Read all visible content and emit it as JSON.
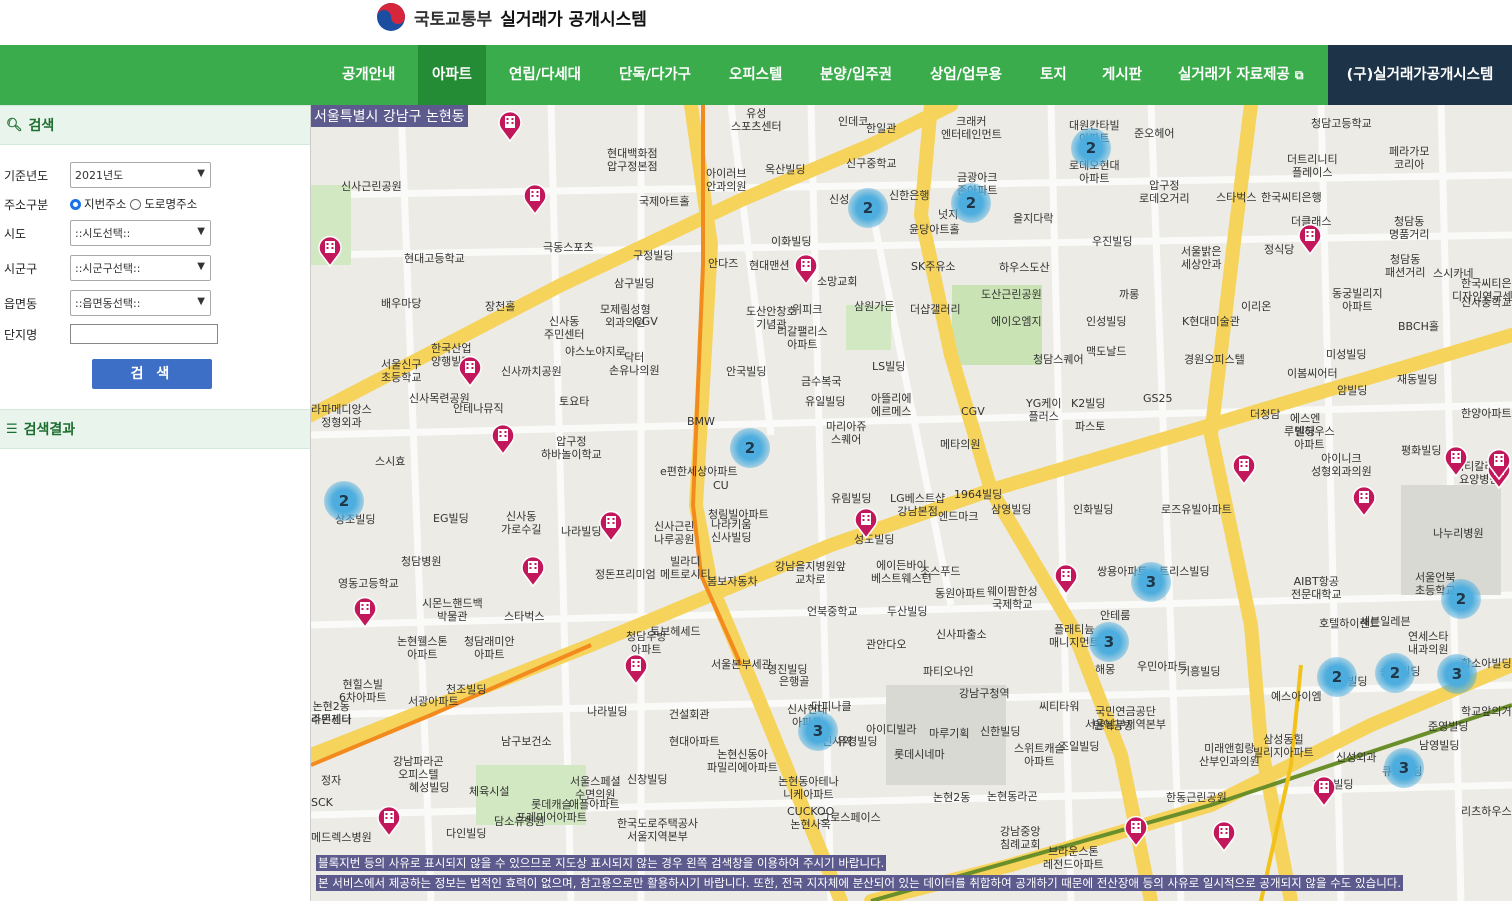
{
  "header": {
    "ministry": "국토교통부",
    "system_name": "실거래가 공개시스템",
    "emblem_icon": "korea-taegeuk-icon"
  },
  "nav": {
    "items": [
      {
        "label": "공개안내"
      },
      {
        "label": "아파트",
        "active": true
      },
      {
        "label": "연립/다세대"
      },
      {
        "label": "단독/다가구"
      },
      {
        "label": "오피스텔"
      },
      {
        "label": "분양/입주권"
      },
      {
        "label": "상업/업무용"
      },
      {
        "label": "토지"
      },
      {
        "label": "게시판"
      },
      {
        "label": "실거래가 자료제공"
      }
    ],
    "legacy_label": "(구)실거래가공개시스템",
    "accent": "#3aac4b",
    "legacy_bg": "#1d3348"
  },
  "sidebar": {
    "search_title": "검색",
    "results_title": "검색결과",
    "fields": {
      "year_label": "기준년도",
      "year_value": "2021년도",
      "addr_label": "주소구분",
      "addr_option1": "지번주소",
      "addr_option2": "도로명주소",
      "sido_label": "시도",
      "sido_value": "::시도선택::",
      "sigungu_label": "시군구",
      "sigungu_value": "::시군구선택::",
      "dong_label": "읍면동",
      "dong_value": "::읍면동선택::",
      "complex_label": "단지명",
      "complex_value": ""
    },
    "search_button": "검 색"
  },
  "map": {
    "region_label": "서울특별시 강남구 논현동",
    "notice1": "블록지번 등의 사유로 표시되지 않을 수 있으므로 지도상 표시되지 않는 경우 왼쪽 검색창을 이용하여 주시기 바랍니다.",
    "notice2": "본 서비스에서 제공하는 정보는 법적인 효력이 없으며, 참고용으로만 활용하시기 바랍니다. 또한, 전국 지자체에 분산되어 있는 데이터를 취합하여 공개하기 때문에 전산장애 등의 사유로 일시적으로 공개되지 않을 수도 있습니다.",
    "labels": [
      {
        "text": "유성\n스포츠센터"
      },
      {
        "text": "인데코"
      },
      {
        "text": "한일관"
      },
      {
        "text": "크래커\n엔터테인먼트"
      },
      {
        "text": "대원칸타빌\n아파트"
      },
      {
        "text": "준오헤어"
      },
      {
        "text": "청담고등학교"
      },
      {
        "text": "신사근린공원"
      },
      {
        "text": "현대백화점\n압구정본점"
      },
      {
        "text": "신구중학교"
      },
      {
        "text": "금광아크\n존아파트"
      },
      {
        "text": "로데오현대\n아파트"
      },
      {
        "text": "더트리니티\n플레이스"
      },
      {
        "text": "페라가모\n코리아"
      },
      {
        "text": "국제아트홀"
      },
      {
        "text": "옥산빌딩"
      },
      {
        "text": "신성"
      },
      {
        "text": "신한은행"
      },
      {
        "text": "압구정\n로데오거리"
      },
      {
        "text": "스타벅스"
      },
      {
        "text": "한국씨티은행"
      },
      {
        "text": "아이러브\n안과의원"
      },
      {
        "text": "윤당아트홀"
      },
      {
        "text": "넛지"
      },
      {
        "text": "을지다락"
      },
      {
        "text": "더클래스"
      },
      {
        "text": "청담동\n명품거리"
      },
      {
        "text": "극동스포츠"
      },
      {
        "text": "구정빌딩"
      },
      {
        "text": "이화빌딩"
      },
      {
        "text": "우진빌딩"
      },
      {
        "text": "서울밝은\n세상안과"
      },
      {
        "text": "정식당"
      },
      {
        "text": "현대고등학교"
      },
      {
        "text": "안다즈"
      },
      {
        "text": "현대맨션"
      },
      {
        "text": "소망교회"
      },
      {
        "text": "SK주유소"
      },
      {
        "text": "하우스도산"
      },
      {
        "text": "청담동\n패션거리"
      },
      {
        "text": "스시카네"
      },
      {
        "text": "한국씨티은행"
      },
      {
        "text": "삼구빌딩"
      },
      {
        "text": "위피크"
      },
      {
        "text": "삼원가든"
      },
      {
        "text": "더샵갤러리"
      },
      {
        "text": "도산근린공원"
      },
      {
        "text": "까롱"
      },
      {
        "text": "K현대미술관"
      },
      {
        "text": "동궁빌리지\n아파트"
      },
      {
        "text": "디자인연구센터"
      },
      {
        "text": "신사중학교"
      },
      {
        "text": "배우마당"
      },
      {
        "text": "장천홀"
      },
      {
        "text": "모제림성형\n외과의원"
      },
      {
        "text": "CGV"
      },
      {
        "text": "리갈팰리스\n아파트"
      },
      {
        "text": "도산안창호\n기념관"
      },
      {
        "text": "에이오엠지"
      },
      {
        "text": "인성빌딩"
      },
      {
        "text": "이리온"
      },
      {
        "text": "BBCH홀"
      },
      {
        "text": "신사동\n주민센터"
      },
      {
        "text": "한국산업\n양행빌딩"
      },
      {
        "text": "야스노야지로"
      },
      {
        "text": "닥터\n손유나의원"
      },
      {
        "text": "맥도날드"
      },
      {
        "text": "경원오피스텔"
      },
      {
        "text": "미성빌딩"
      },
      {
        "text": "서울신구\n초등학교"
      },
      {
        "text": "신사까치공원"
      },
      {
        "text": "안국빌딩"
      },
      {
        "text": "금수복국"
      },
      {
        "text": "LS빌딩"
      },
      {
        "text": "청담스퀘어"
      },
      {
        "text": "이봄씨어터"
      },
      {
        "text": "재동빌딩"
      },
      {
        "text": "신사목련공원"
      },
      {
        "text": "안테나뮤직"
      },
      {
        "text": "토요타"
      },
      {
        "text": "유일빌딩"
      },
      {
        "text": "아뜰리에\n에르메스"
      },
      {
        "text": "CGV"
      },
      {
        "text": "YG케이\n플러스"
      },
      {
        "text": "K2빌딩"
      },
      {
        "text": "GS25"
      },
      {
        "text": "더청담"
      },
      {
        "text": "에스엔\n빌딩"
      },
      {
        "text": "암빌딩"
      },
      {
        "text": "한양아파트"
      },
      {
        "text": "라파메디앙스\n정형외과"
      },
      {
        "text": "압구정\n하바놀이학교"
      },
      {
        "text": "BMW"
      },
      {
        "text": "마리아쥬\n스퀘어"
      },
      {
        "text": "메타의원"
      },
      {
        "text": "파스토"
      },
      {
        "text": "루덴하우스\n아파트"
      },
      {
        "text": "아이니크\n성형외과의원"
      },
      {
        "text": "평화빌딩"
      },
      {
        "text": "씨티칼리지\n요양병원"
      },
      {
        "text": "스시효"
      },
      {
        "text": "e편한세상아파트"
      },
      {
        "text": "CU"
      },
      {
        "text": "유림빌딩"
      },
      {
        "text": "LG베스트샵\n강남본점"
      },
      {
        "text": "1964빌딩"
      },
      {
        "text": "EG빌딩"
      },
      {
        "text": "신사동\n가로수길"
      },
      {
        "text": "청림빌아파트"
      },
      {
        "text": "삼영빌딩"
      },
      {
        "text": "인화빌딩"
      },
      {
        "text": "로즈유빌아파트"
      },
      {
        "text": "상조빌딩"
      },
      {
        "text": "나라빌딩"
      },
      {
        "text": "신사근린\n나루공원"
      },
      {
        "text": "나라키움\n신사빌딩"
      },
      {
        "text": "성도빌딩"
      },
      {
        "text": "엔드마크"
      },
      {
        "text": "나누리병원"
      },
      {
        "text": "청담병원"
      },
      {
        "text": "빌라디\n메트로시티"
      },
      {
        "text": "강남을지병원앞\n교차로"
      },
      {
        "text": "에이든바이\n베스트웨스턴"
      },
      {
        "text": "조스푸드"
      },
      {
        "text": "트리스빌딩"
      },
      {
        "text": "AIBT항공\n전문대학교"
      },
      {
        "text": "영동고등학교"
      },
      {
        "text": "정돈프리미엄"
      },
      {
        "text": "봄보자동차"
      },
      {
        "text": "쌍용아파트"
      },
      {
        "text": "서울언북\n초등학교"
      },
      {
        "text": "시몬느핸드백\n박물관"
      },
      {
        "text": "스타벅스"
      },
      {
        "text": "언북중학교"
      },
      {
        "text": "두산빌딩"
      },
      {
        "text": "동원아파트"
      },
      {
        "text": "웨이팜한성\n국제학교"
      },
      {
        "text": "안테룸"
      },
      {
        "text": "호텔하이랜드"
      },
      {
        "text": "세븐일레븐"
      },
      {
        "text": "연세스타\n내과의원"
      },
      {
        "text": "논현웰스톤\n아파트"
      },
      {
        "text": "청담래미안\n아파트"
      },
      {
        "text": "청담우방\n아파트"
      },
      {
        "text": "관안다오"
      },
      {
        "text": "신사파출소"
      },
      {
        "text": "토브헤세드"
      },
      {
        "text": "서울본부세관"
      },
      {
        "text": "은행골"
      },
      {
        "text": "파티오나인"
      },
      {
        "text": "플래티늄\n매니지먼트"
      },
      {
        "text": "해몽"
      },
      {
        "text": "우민아파트"
      },
      {
        "text": "기흥빌딩"
      },
      {
        "text": "예스아이엠"
      },
      {
        "text": "준영빌딩"
      },
      {
        "text": "함소아빌딩"
      },
      {
        "text": "현힐스빌\n6차아파트"
      },
      {
        "text": "천조빌딩"
      },
      {
        "text": "나라빌딩"
      },
      {
        "text": "건설회관"
      },
      {
        "text": "영진빌딩"
      },
      {
        "text": "더피나클"
      },
      {
        "text": "강남구청역"
      },
      {
        "text": "씨티타워"
      },
      {
        "text": "국민연금공단\n서울남부지역본부"
      },
      {
        "text": "아령빌딩"
      },
      {
        "text": "송암빌딩"
      },
      {
        "text": "논현2동\n주민센터"
      },
      {
        "text": "서광아파트"
      },
      {
        "text": "현대아파트"
      },
      {
        "text": "신사현대\n아파트"
      },
      {
        "text": "아이디빌라"
      },
      {
        "text": "마루기획"
      },
      {
        "text": "신한빌딩"
      },
      {
        "text": "면역공방"
      },
      {
        "text": "학교앞의거리"
      },
      {
        "text": "라온제나"
      },
      {
        "text": "강남파라곤\n오피스텔"
      },
      {
        "text": "남구보건소"
      },
      {
        "text": "신사역"
      },
      {
        "text": "롯데시네마"
      },
      {
        "text": "스위트캐슬\n아파트"
      },
      {
        "text": "조일빌딩"
      },
      {
        "text": "미래앤힘랑\n산부인과의원"
      },
      {
        "text": "삼성동힐\n빌리지아파트"
      },
      {
        "text": "신성외과"
      },
      {
        "text": "큐브빌딩"
      },
      {
        "text": "정자"
      },
      {
        "text": "체육시설"
      },
      {
        "text": "서울스페셜\n수면의원"
      },
      {
        "text": "신창빌딩"
      },
      {
        "text": "유경빌딩"
      },
      {
        "text": "강남중앙\n침례교회"
      },
      {
        "text": "브라운스톤\n레전드아파트"
      },
      {
        "text": "한동근린공원"
      },
      {
        "text": "마루빌딩"
      },
      {
        "text": "SCK"
      },
      {
        "text": "혜성빌딩"
      },
      {
        "text": "다인빌딩"
      },
      {
        "text": "롯데캐슬\n프레미어아파트"
      },
      {
        "text": "애플아파트"
      },
      {
        "text": "논현신동아\n파밀리에아파트"
      },
      {
        "text": "논현동아테나\n니케아파트"
      },
      {
        "text": "CUCKOO\n논현사옥"
      },
      {
        "text": "논현동라곤"
      },
      {
        "text": "남영빌딩"
      },
      {
        "text": "리츠하우스"
      },
      {
        "text": "메드렉스병원"
      },
      {
        "text": "담소유병원"
      },
      {
        "text": "한국도로주택공사\n서울지역본부"
      },
      {
        "text": "그로스페이스"
      },
      {
        "text": "논현2동"
      }
    ],
    "clusters": [
      {
        "count": "2"
      },
      {
        "count": "2"
      },
      {
        "count": "2"
      },
      {
        "count": "2"
      },
      {
        "count": "2"
      },
      {
        "count": "3"
      },
      {
        "count": "3"
      },
      {
        "count": "3"
      },
      {
        "count": "2"
      },
      {
        "count": "2"
      },
      {
        "count": "2"
      },
      {
        "count": "3"
      },
      {
        "count": "3"
      }
    ],
    "pin_icon": "apartment-marker-icon",
    "road_color": "#f6d35b",
    "subway_color": "#f28a1e"
  }
}
